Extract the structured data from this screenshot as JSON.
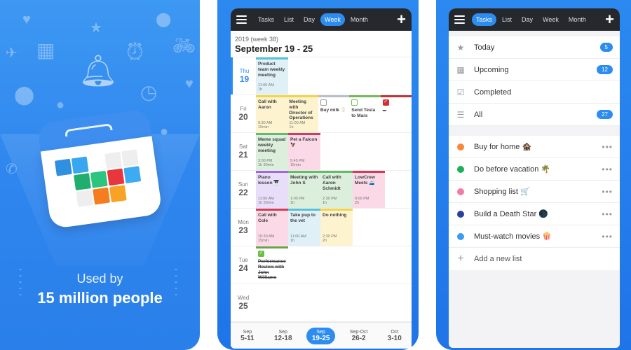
{
  "promo": {
    "line1": "Used by",
    "line2": "15 million people",
    "grid_colors": [
      "#2f8fe0",
      "#3aa6ef",
      "#ffffff",
      "#eeeeee",
      "#eeeeee",
      "#ffffff",
      "#1fae6d",
      "#2cc47e",
      "#e9363e",
      "#3eaaf2",
      "#ffffff",
      "#eeeeee",
      "#f57c1f",
      "#f9a326",
      "#ffffff"
    ],
    "bg_icons": [
      "heart-icon",
      "star-icon",
      "map-pin-icon",
      "airplane-icon",
      "calendar-icon",
      "bell-icon",
      "alarm-clock-icon",
      "bicycle-icon",
      "clock-icon",
      "location-icon",
      "chat-bubble-icon",
      "phone-icon",
      "person-icon"
    ]
  },
  "week_screen": {
    "tabs": [
      {
        "label": "Tasks",
        "active": false
      },
      {
        "label": "List",
        "active": false
      },
      {
        "label": "Day",
        "active": false
      },
      {
        "label": "Week",
        "active": true
      },
      {
        "label": "Month",
        "active": false
      }
    ],
    "subtitle": "2019 (week 38)",
    "title": "September 19 - 25",
    "days": [
      {
        "dn": "Thu",
        "dd": "19",
        "today": true,
        "events": [
          {
            "name": "Product team weekly meeting",
            "time": "11:00 AM",
            "dur": "1h",
            "bg": "#dff1f7",
            "bar": "#55c2d6"
          }
        ]
      },
      {
        "dn": "Fri",
        "dd": "20",
        "events": [
          {
            "name": "Call with Aaron",
            "time": "9:30 AM",
            "dur": "15min",
            "bg": "#fdf3cf",
            "bar": "#f2d44a"
          },
          {
            "name": "Meeting with Director of Operations",
            "time": "11:00 AM",
            "dur": "1h",
            "bg": "#fdf3cf",
            "bar": "#f2d44a"
          },
          {
            "name": "Buy milk 🥛",
            "task": true,
            "done": false,
            "bg": "#ffffff",
            "bar": "#b9bfc9",
            "chk": "#999999"
          },
          {
            "name": "Send Tesla to Mars",
            "task": true,
            "done": false,
            "bg": "#ffffff",
            "bar": "#7ab65a",
            "chk": "#7ab65a"
          },
          {
            "name": "...",
            "task": true,
            "done": true,
            "bg": "#ffffff",
            "bar": "#c0343b",
            "chk": "#d42c35"
          }
        ]
      },
      {
        "dn": "Sat",
        "dd": "21",
        "events": [
          {
            "name": "Meme squad weekly meeting",
            "time": "3:00 PM",
            "dur": "1h 30min",
            "bg": "#dcefdc",
            "bar": "#66bb6a"
          },
          {
            "name": "Pet a Falcon 🦅",
            "time": "5:45 PM",
            "dur": "15min",
            "bg": "#fbd9e6",
            "bar": "#d23b5a"
          }
        ]
      },
      {
        "dn": "Sun",
        "dd": "22",
        "events": [
          {
            "name": "Piano lesson 🎹",
            "time": "11:00 AM",
            "dur": "1h 30min",
            "bg": "#e9defa",
            "bar": "#9b6bd6"
          },
          {
            "name": "Meeting with John S",
            "time": "1:00 PM",
            "dur": "1h",
            "bg": "#dcefdc",
            "bar": "#66bb6a"
          },
          {
            "name": "Call with Aaron Schmidt",
            "time": "2:30 PM",
            "dur": "1h",
            "bg": "#dcefdc",
            "bar": "#66bb6a"
          },
          {
            "name": "LowCrew Meets 🚄",
            "time": "8:00 PM",
            "dur": "2h",
            "bg": "#fbd9e6",
            "bar": "#d23b5a"
          }
        ]
      },
      {
        "dn": "Mon",
        "dd": "23",
        "events": [
          {
            "name": "Call with Cole",
            "time": "10:30 AM",
            "dur": "15min",
            "bg": "#fbd9e6",
            "bar": "#d23b5a"
          },
          {
            "name": "Take pup to the vet",
            "time": "11:00 AM",
            "dur": "1h",
            "bg": "#dff1f7",
            "bar": "#55c2d6"
          },
          {
            "name": "Do nothing",
            "time": "2:30 PM",
            "dur": "2h",
            "bg": "#fdf3cf",
            "bar": "#f2d44a"
          }
        ]
      },
      {
        "dn": "Tue",
        "dd": "24",
        "events": [
          {
            "name": "Performance Review with John Williams",
            "task": true,
            "done": true,
            "bg": "#ffffff",
            "bar": "#6ea04a",
            "chk": "#6cbf45"
          }
        ]
      },
      {
        "dn": "Wed",
        "dd": "25",
        "events": []
      }
    ],
    "week_nav": [
      {
        "m": "Sep",
        "r": "5-11",
        "active": false
      },
      {
        "m": "Sep",
        "r": "12-18",
        "active": false
      },
      {
        "m": "Sep",
        "r": "19-25",
        "active": true
      },
      {
        "m": "Sep-Oct",
        "r": "26-2",
        "active": false
      },
      {
        "m": "Oct",
        "r": "3-10",
        "active": false
      }
    ]
  },
  "tasks_screen": {
    "tabs": [
      {
        "label": "Tasks",
        "active": true
      },
      {
        "label": "List",
        "active": false
      },
      {
        "label": "Day",
        "active": false
      },
      {
        "label": "Week",
        "active": false
      },
      {
        "label": "Month",
        "active": false
      }
    ],
    "filters": [
      {
        "icon": "star-icon",
        "glyph": "★",
        "label": "Today",
        "count": "5"
      },
      {
        "icon": "calendar-icon",
        "glyph": "▦",
        "label": "Upcoming",
        "count": "12"
      },
      {
        "icon": "checkbox-icon",
        "glyph": "☑",
        "label": "Completed",
        "count": null
      },
      {
        "icon": "list-icon",
        "glyph": "☰",
        "label": "All",
        "count": "27"
      }
    ],
    "lists": [
      {
        "label": "Buy for home 🏚️",
        "color": "#f5883a"
      },
      {
        "label": "Do before vacation 🌴",
        "color": "#1fae5a"
      },
      {
        "label": "Shopping list 🛒",
        "color": "#f27aa8"
      },
      {
        "label": "Build a Death Star 🌑",
        "color": "#2e3f9e"
      },
      {
        "label": "Must-watch movies 🍿",
        "color": "#3d9bef"
      }
    ],
    "more_label": "•••",
    "add_list_label": "Add a new list"
  }
}
